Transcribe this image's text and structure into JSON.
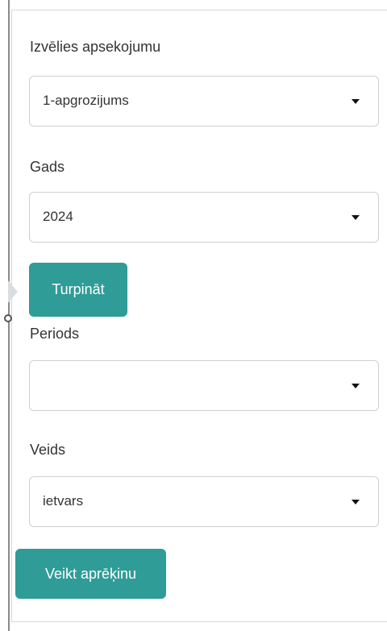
{
  "survey": {
    "label": "Izvēlies apsekojumu",
    "selected": "1-apgrozijums"
  },
  "year": {
    "label": "Gads",
    "selected": "2024"
  },
  "continue_button": {
    "label": "Turpināt"
  },
  "period": {
    "label": "Periods",
    "selected": ""
  },
  "type": {
    "label": "Veids",
    "selected": "ietvars"
  },
  "calculate_button": {
    "label": "Veikt aprēķinu"
  },
  "colors": {
    "accent": "#2f9c97",
    "border": "#cfcfcf",
    "text": "#333333"
  },
  "icons": {
    "caret": "caret-down-icon",
    "toggle": "sidebar-toggle-icon",
    "handle": "resize-handle-icon"
  }
}
